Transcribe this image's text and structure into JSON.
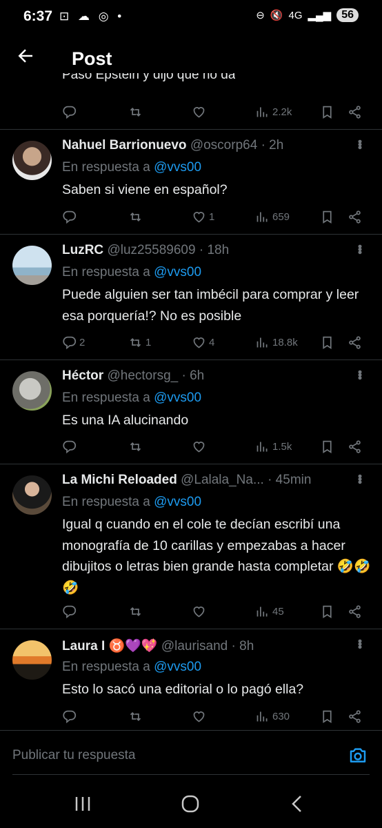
{
  "status": {
    "time": "6:37",
    "left_icons": "⊡ ☁ ◎ •",
    "network": "4G",
    "battery": "56"
  },
  "header": {
    "title": "Post"
  },
  "partial_text": "Paso Epstein y dijo que no da",
  "partial_actions": {
    "views": "2.2k"
  },
  "reply_prefix": "En respuesta a",
  "tweets": [
    {
      "name": "Nahuel Barrionuevo",
      "handle": "@oscorp64",
      "time": "· 2h",
      "reply_to": "@vvs00",
      "text": "Saben si viene en español?",
      "replies": "",
      "reposts": "",
      "likes": "1",
      "views": "659"
    },
    {
      "name": "LuzRC",
      "handle": "@luz25589609",
      "time": "· 18h",
      "reply_to": "@vvs00",
      "text": "Puede alguien ser tan imbécil para comprar y leer esa porquería!? No es posible",
      "replies": "2",
      "reposts": "1",
      "likes": "4",
      "views": "18.8k"
    },
    {
      "name": "Héctor",
      "handle": "@hectorsg_",
      "time": "· 6h",
      "reply_to": "@vvs00",
      "text": "Es una IA alucinando",
      "replies": "",
      "reposts": "",
      "likes": "",
      "views": "1.5k"
    },
    {
      "name": "La Michi Reloaded",
      "handle": "@Lalala_Na...",
      "time": "· 45min",
      "reply_to": "@vvs00",
      "text": "Igual q cuando en el cole te decían escribí una monografía de 10 carillas y empezabas a hacer dibujitos o letras bien grande hasta completar 🤣🤣🤣",
      "replies": "",
      "reposts": "",
      "likes": "",
      "views": "45"
    },
    {
      "name": "Laura I ♉💜💖",
      "handle": "@laurisand",
      "time": "· 8h",
      "reply_to": "@vvs00",
      "text": "Esto lo sacó una editorial o lo pagó ella?",
      "replies": "",
      "reposts": "",
      "likes": "",
      "views": "630"
    }
  ],
  "compose": {
    "placeholder": "Publicar tu respuesta"
  },
  "colors": {
    "accent": "#1d9bf0",
    "muted": "#71767b",
    "divider": "#2f3336"
  }
}
